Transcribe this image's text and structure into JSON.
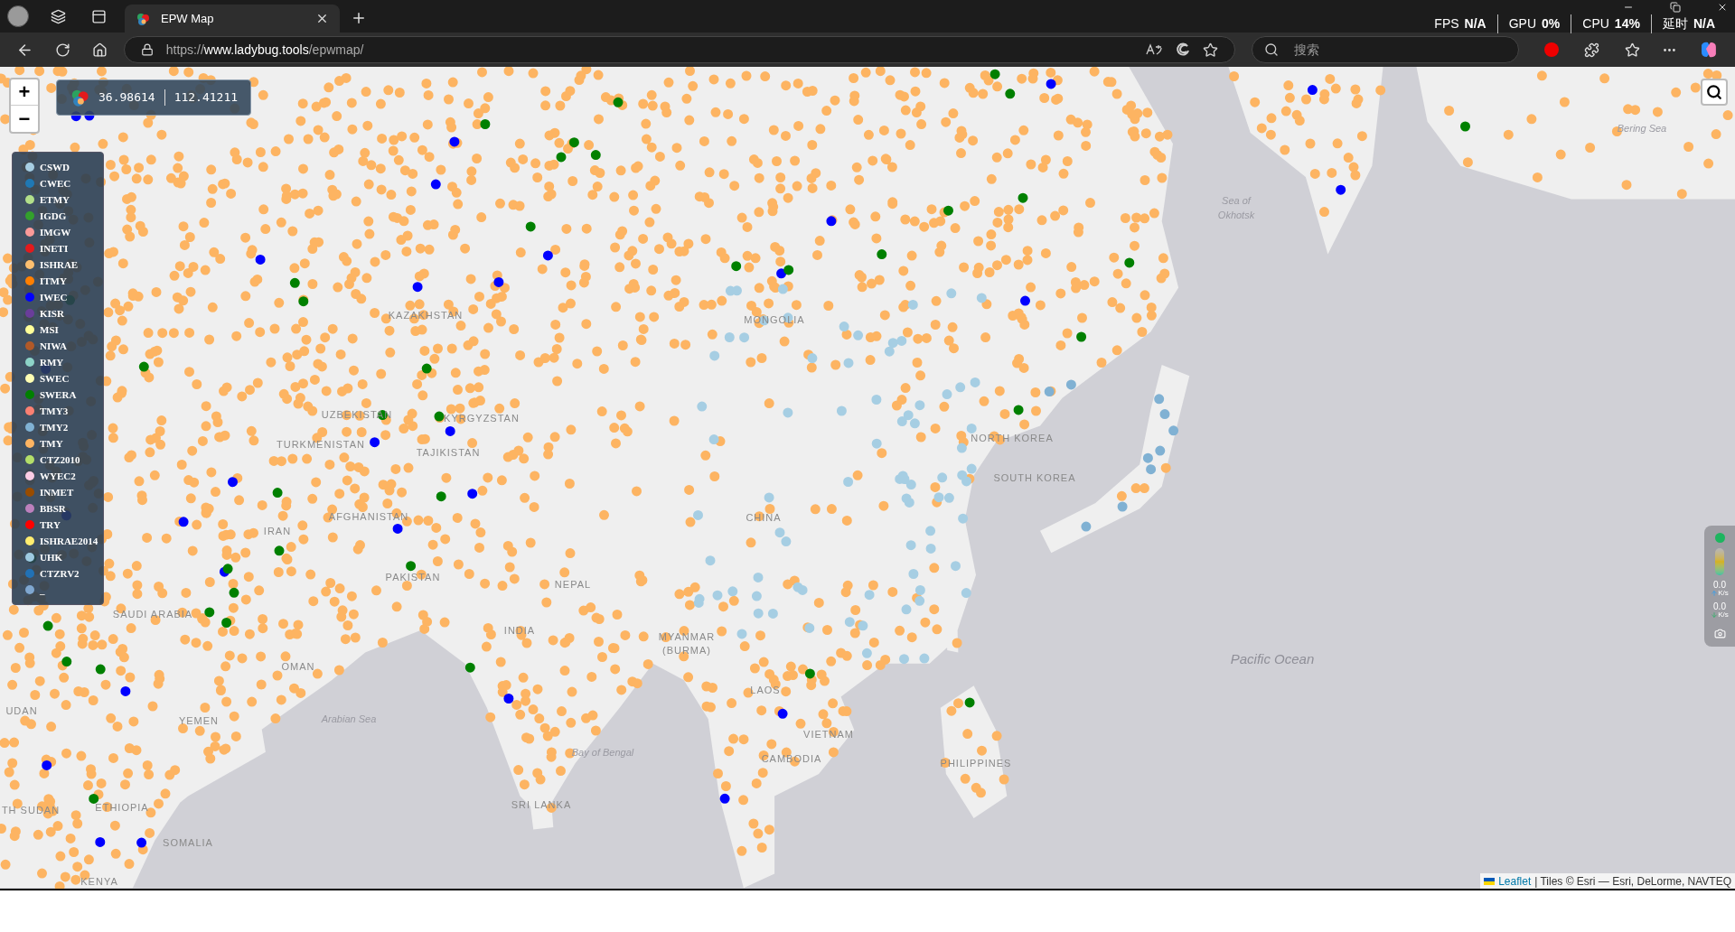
{
  "browser": {
    "tabs": [
      {
        "title": "EPW Map",
        "selected": true
      }
    ],
    "url": {
      "scheme": "https://",
      "host": "www.ladybug.tools",
      "path": "/epwmap/"
    },
    "search": {
      "placeholder": "搜索"
    }
  },
  "perf_overlay": [
    {
      "label": "FPS",
      "value": "N/A"
    },
    {
      "label": "GPU",
      "value": "0%"
    },
    {
      "label": "CPU",
      "value": "14%"
    },
    {
      "label": "延时",
      "value": "N/A"
    }
  ],
  "map": {
    "zoom_in": "+",
    "zoom_out": "−",
    "coordinates": {
      "lat": "36.98614",
      "lon": "112.41211"
    },
    "legend": [
      {
        "name": "CSWD",
        "color": "#a6cee3"
      },
      {
        "name": "CWEC",
        "color": "#1f78b4"
      },
      {
        "name": "ETMY",
        "color": "#b2df8a"
      },
      {
        "name": "IGDG",
        "color": "#33a02c"
      },
      {
        "name": "IMGW",
        "color": "#fb9a99"
      },
      {
        "name": "INETI",
        "color": "#e31a1c"
      },
      {
        "name": "ISHRAE",
        "color": "#fdbf6f"
      },
      {
        "name": "ITMY",
        "color": "#ff7f00"
      },
      {
        "name": "IWEC",
        "color": "#0000ff"
      },
      {
        "name": "KISR",
        "color": "#6a3d9a"
      },
      {
        "name": "MSI",
        "color": "#ffff99"
      },
      {
        "name": "NIWA",
        "color": "#b15928"
      },
      {
        "name": "RMY",
        "color": "#8dd3c7"
      },
      {
        "name": "SWEC",
        "color": "#ffffb3"
      },
      {
        "name": "SWERA",
        "color": "#008000"
      },
      {
        "name": "TMY3",
        "color": "#fb8072"
      },
      {
        "name": "TMY2",
        "color": "#80b1d3"
      },
      {
        "name": "TMY",
        "color": "#fdb462"
      },
      {
        "name": "CTZ2010",
        "color": "#b3de69"
      },
      {
        "name": "WYEC2",
        "color": "#fccde5"
      },
      {
        "name": "INMET",
        "color": "#994c00"
      },
      {
        "name": "BBSR",
        "color": "#bc80bd"
      },
      {
        "name": "TRY",
        "color": "#ff0000"
      },
      {
        "name": "ISHRAE2014",
        "color": "#ffed6f"
      },
      {
        "name": "UHK",
        "color": "#9ecae1"
      },
      {
        "name": "CTZRV2",
        "color": "#2171b5"
      },
      {
        "name": "_",
        "color": "#7fa7d0"
      }
    ],
    "labels": [
      {
        "text": "Bering Sea",
        "kind": "sea"
      },
      {
        "text": "Sea of",
        "kind": "sea"
      },
      {
        "text": "Okhotsk",
        "kind": "sea"
      },
      {
        "text": "KAZAKHSTAN",
        "kind": "country"
      },
      {
        "text": "MONGOLIA",
        "kind": "country"
      },
      {
        "text": "UZBEKISTAN",
        "kind": "country"
      },
      {
        "text": "KYRGYZSTAN",
        "kind": "country"
      },
      {
        "text": "TURKMENISTAN",
        "kind": "country"
      },
      {
        "text": "TAJIKISTAN",
        "kind": "country"
      },
      {
        "text": "NORTH KOREA",
        "kind": "country"
      },
      {
        "text": "SOUTH KOREA",
        "kind": "country"
      },
      {
        "text": "AFGHANISTAN",
        "kind": "country"
      },
      {
        "text": "IRAN",
        "kind": "country"
      },
      {
        "text": "CHINA",
        "kind": "country"
      },
      {
        "text": "PAKISTAN",
        "kind": "country"
      },
      {
        "text": "NEPAL",
        "kind": "country"
      },
      {
        "text": "INDIA",
        "kind": "country"
      },
      {
        "text": "MYANMAR",
        "kind": "country"
      },
      {
        "text": "(BURMA)",
        "kind": "country"
      },
      {
        "text": "OMAN",
        "kind": "country"
      },
      {
        "text": "Pacific Ocean",
        "kind": "ocean"
      },
      {
        "text": "Arabian Sea",
        "kind": "sea"
      },
      {
        "text": "LAOS",
        "kind": "country"
      },
      {
        "text": "Bay of Bengal",
        "kind": "sea"
      },
      {
        "text": "VIETNAM",
        "kind": "country"
      },
      {
        "text": "CAMBODIA",
        "kind": "country"
      },
      {
        "text": "PHILIPPINES",
        "kind": "country"
      },
      {
        "text": "SRI LANKA",
        "kind": "country"
      },
      {
        "text": "SAUDI ARABIA",
        "kind": "country"
      },
      {
        "text": "YEMEN",
        "kind": "country"
      },
      {
        "text": "UDAN",
        "kind": "country"
      },
      {
        "text": "TH SUDAN",
        "kind": "country"
      },
      {
        "text": "ETHIOPIA",
        "kind": "country"
      },
      {
        "text": "SOMALIA",
        "kind": "country"
      },
      {
        "text": "KENYA",
        "kind": "country"
      }
    ],
    "attribution": {
      "link": "Leaflet",
      "text": "| Tiles © Esri — Esri, DeLorme, NAVTEQ"
    }
  },
  "net_widget": {
    "rates": [
      {
        "value": "0.0",
        "unit": "K/s",
        "kind": "upload"
      },
      {
        "value": "0.0",
        "unit": "K/s",
        "kind": "download"
      }
    ]
  }
}
